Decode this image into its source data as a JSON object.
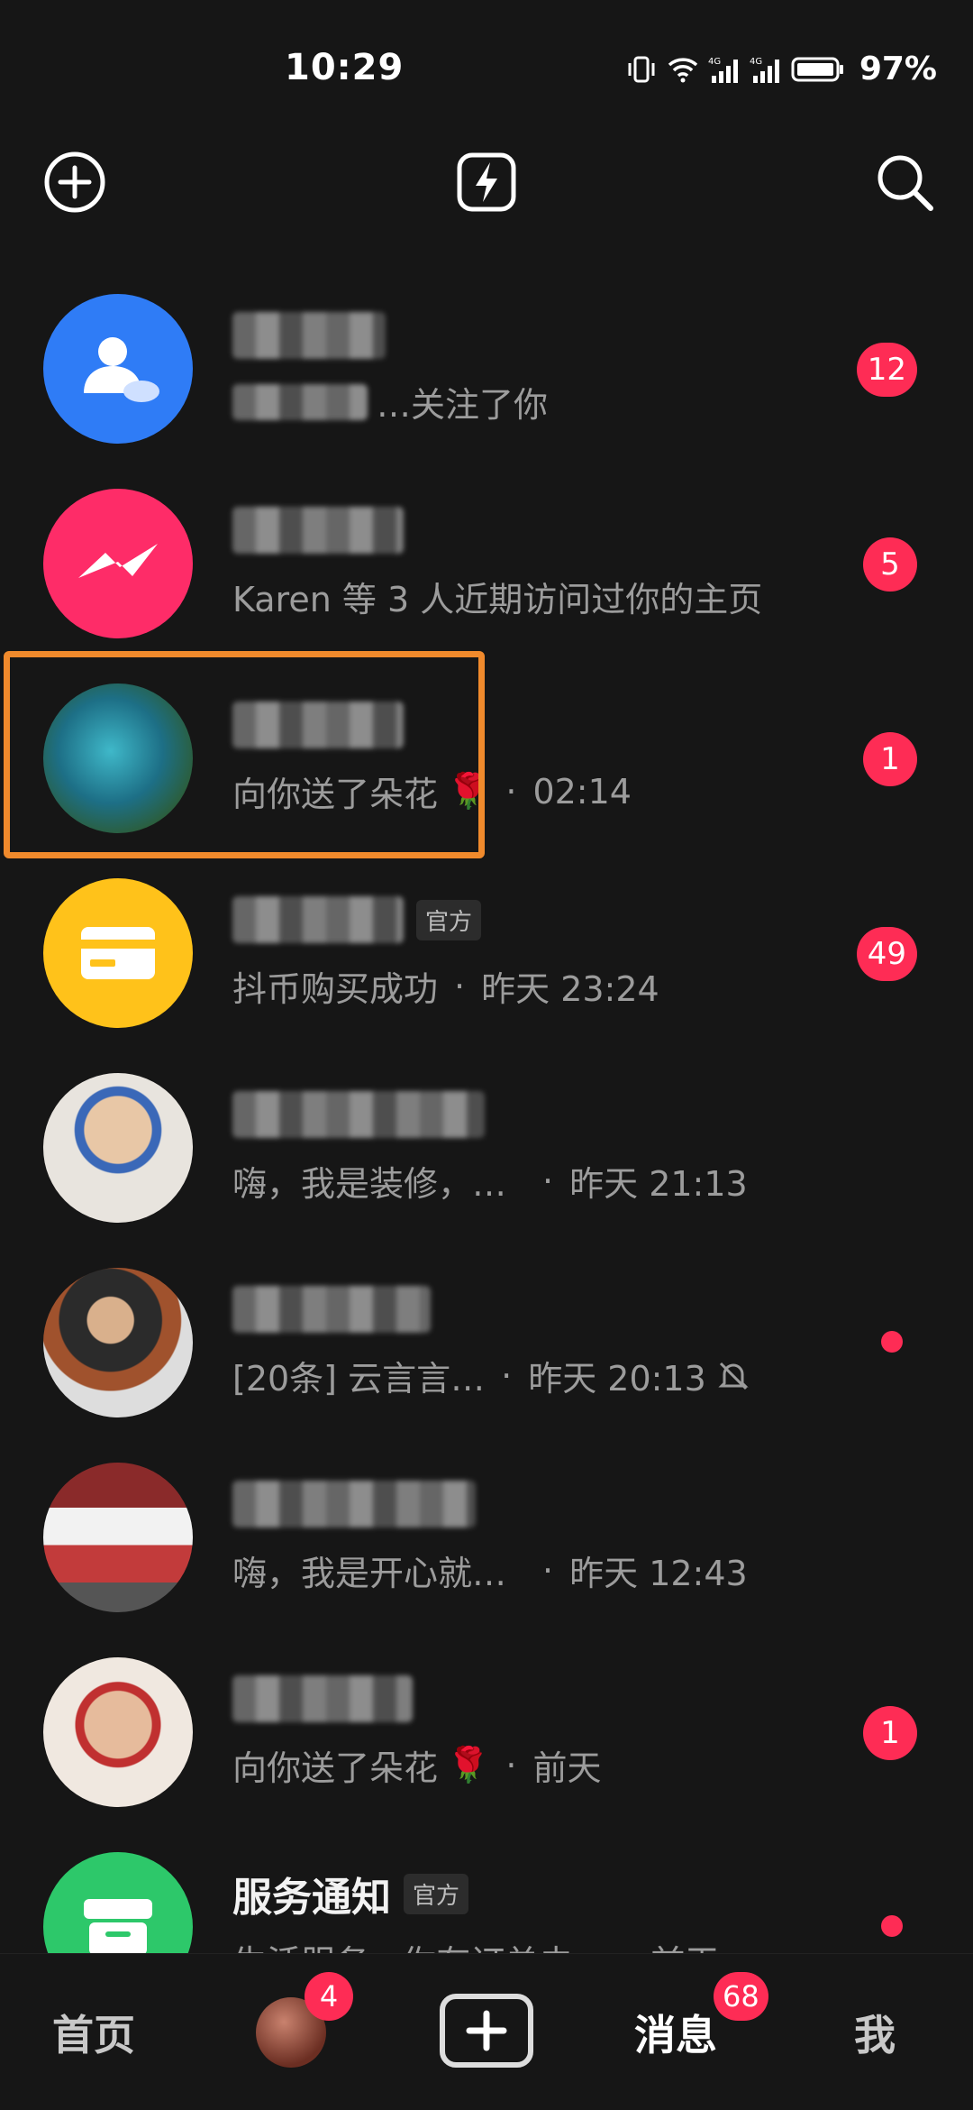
{
  "status_bar": {
    "time": "10:29",
    "battery": "97%",
    "icons": [
      "vibrate-icon",
      "wifi-icon",
      "signal-4g-icon",
      "signal-4g-icon",
      "battery-icon"
    ]
  },
  "top_bar": {
    "icons": [
      "add-circle-icon",
      "flash-icon",
      "search-icon"
    ]
  },
  "conversations": [
    {
      "name": "",
      "subtitle": "…关注了你",
      "time": "",
      "badge": "12",
      "avatar_color": "#2f7cf6",
      "avatar_icon": "new-followers-icon"
    },
    {
      "name": "",
      "subtitle": "Karen 等 3 人近期访问过你的主页",
      "time": "",
      "badge": "5",
      "avatar_color": "#fe2c68",
      "avatar_icon": "messenger-bolt-icon"
    },
    {
      "name": "",
      "subtitle": "向你送了朵花",
      "flower": "🌹",
      "time": "02:14",
      "badge": "1",
      "avatar_color": "#2a7a6e",
      "avatar_icon": "photo-avatar"
    },
    {
      "name": "",
      "tag": "官方",
      "subtitle": "抖币购买成功",
      "time": "昨天 23:24",
      "badge": "49",
      "avatar_color": "#ffc21a",
      "avatar_icon": "wallet-card-icon"
    },
    {
      "name": "",
      "subtitle": "嗨，我是装修，…",
      "time": "昨天 21:13",
      "badge": "",
      "avatar_color": "#d8c4b0",
      "avatar_icon": "photo-avatar"
    },
    {
      "name": "",
      "subtitle": "[20条] 云言言…",
      "time": "昨天 20:13",
      "muted": true,
      "dot": true,
      "avatar_color": "#5a4a3a",
      "avatar_icon": "photo-avatar"
    },
    {
      "name": "",
      "subtitle": "嗨，我是开心就…",
      "time": "昨天 12:43",
      "badge": "",
      "avatar_color": "#8a3030",
      "avatar_icon": "photo-avatar"
    },
    {
      "name": "",
      "subtitle": "向你送了朵花",
      "flower": "🌹",
      "time": "前天",
      "badge": "1",
      "avatar_color": "#c9a98a",
      "avatar_icon": "photo-avatar"
    },
    {
      "name": "服务通知",
      "tag": "官方",
      "subtitle": "生活服务 · 你有订单未…",
      "time": "前天",
      "dot": true,
      "avatar_color": "#2dc86a",
      "avatar_icon": "service-box-icon"
    }
  ],
  "bottom_nav": {
    "home": "首页",
    "friends_badge": "4",
    "messages": "消息",
    "messages_badge": "68",
    "me": "我"
  },
  "colors": {
    "accent": "#fe2c55",
    "highlight": "#f08a2c",
    "background": "#161616"
  }
}
